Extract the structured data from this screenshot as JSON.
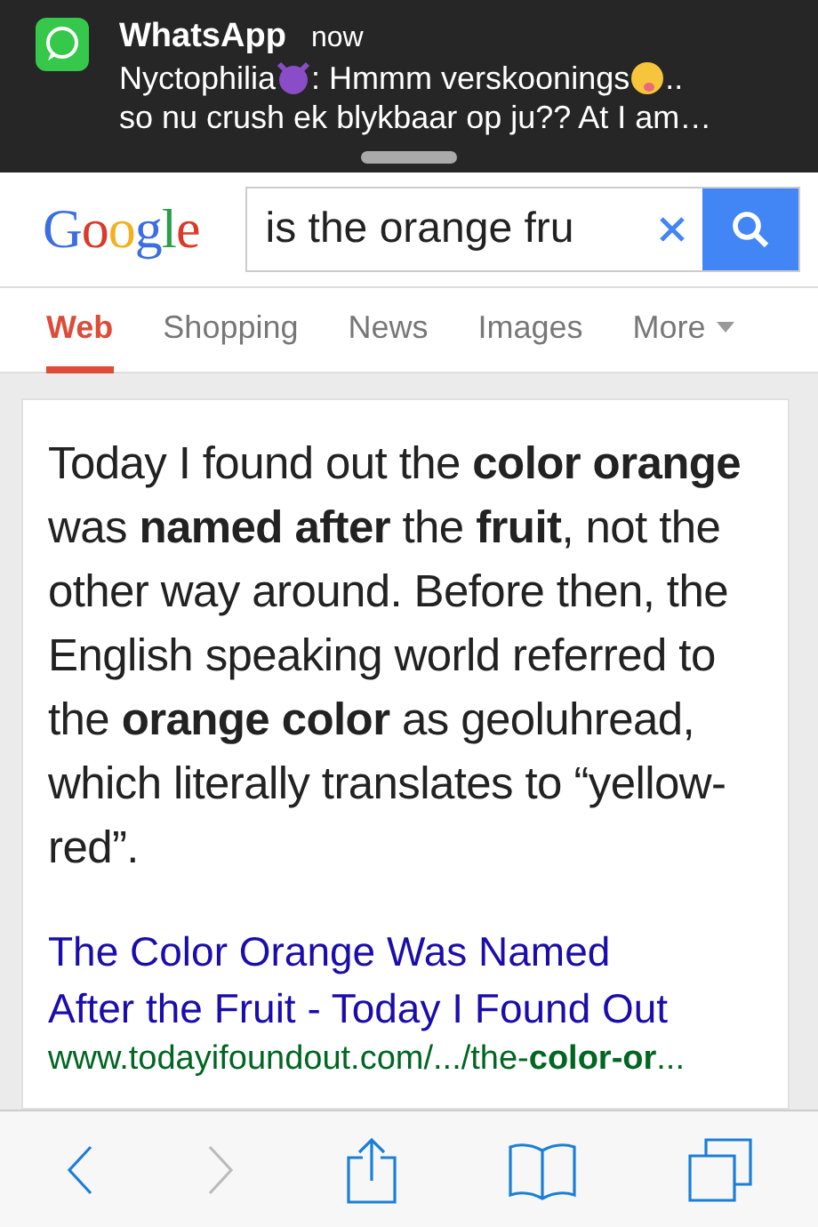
{
  "notification": {
    "app": "WhatsApp",
    "time": "now",
    "line_1": [
      {
        "kind": "text",
        "text": "Nyctophilia"
      },
      {
        "kind": "devil_emoji"
      },
      {
        "kind": "text",
        "text": ": Hmmm verskoonings"
      },
      {
        "kind": "wink_emoji"
      },
      {
        "kind": "text",
        "text": ".."
      }
    ],
    "line_2": "so nu crush ek blykbaar op ju?? At I am…"
  },
  "header": {
    "logo": "Google",
    "search": {
      "value": "is the orange fru"
    }
  },
  "tabs": [
    {
      "label": "Web",
      "selected": true
    },
    {
      "label": "Shopping",
      "selected": false
    },
    {
      "label": "News",
      "selected": false
    },
    {
      "label": "Images",
      "selected": false
    },
    {
      "label": "More",
      "selected": false,
      "dropdown": true
    }
  ],
  "result": {
    "snippet": "Today I found out the **color orange** was **named after** the **fruit**, not the other way around. Before then, the English speaking world referred to the **orange color** as geoluhread, which literally translates to “yellow-red”.",
    "title": "The Color Orange Was Named After the Fruit - Today I Found Out",
    "url": "www.todayifoundout.com/.../the-**color-or**..."
  },
  "toolbar": [
    {
      "kind": "back",
      "disabled": false
    },
    {
      "kind": "forward",
      "disabled": true
    },
    {
      "kind": "share",
      "disabled": false
    },
    {
      "kind": "bookmarks",
      "disabled": false
    },
    {
      "kind": "tabs",
      "disabled": false
    }
  ]
}
